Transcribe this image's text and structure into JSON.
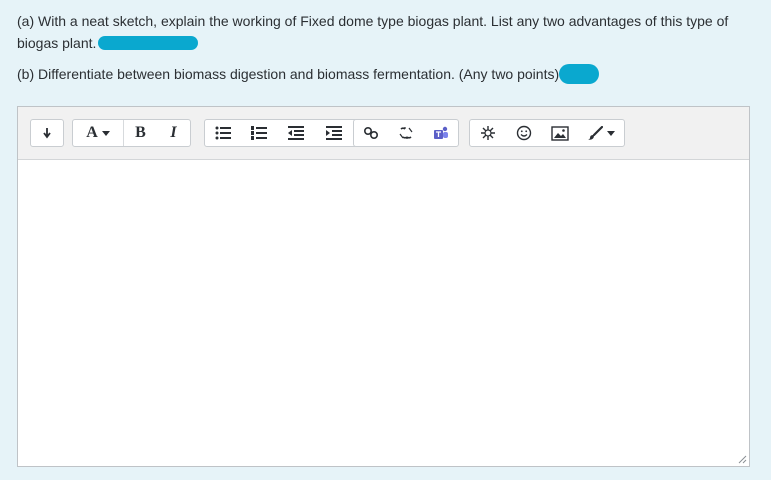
{
  "question": {
    "a_text": "(a) With a neat sketch, explain the working of Fixed dome type biogas plant. List any two advantages of this type of biogas plant.",
    "b_text": "(b) Differentiate between biomass digestion and biomass fermentation. (Any two points)"
  },
  "editor": {
    "toolbar": {
      "toggle_icon": "collapse-toolbar-icon",
      "font_label": "A",
      "bold_label": "B",
      "italic_label": "I",
      "icons": [
        "unordered-list-icon",
        "ordered-list-icon",
        "outdent-icon",
        "indent-icon",
        "link-icon",
        "unlink-icon",
        "teams-meeting-icon",
        "special-character-icon",
        "emoji-icon",
        "image-icon",
        "paint-brush-icon"
      ]
    },
    "content": ""
  },
  "colors": {
    "background": "#e6f3f8",
    "redaction": "#0aa8cf",
    "teams": "#5b5fc7"
  }
}
